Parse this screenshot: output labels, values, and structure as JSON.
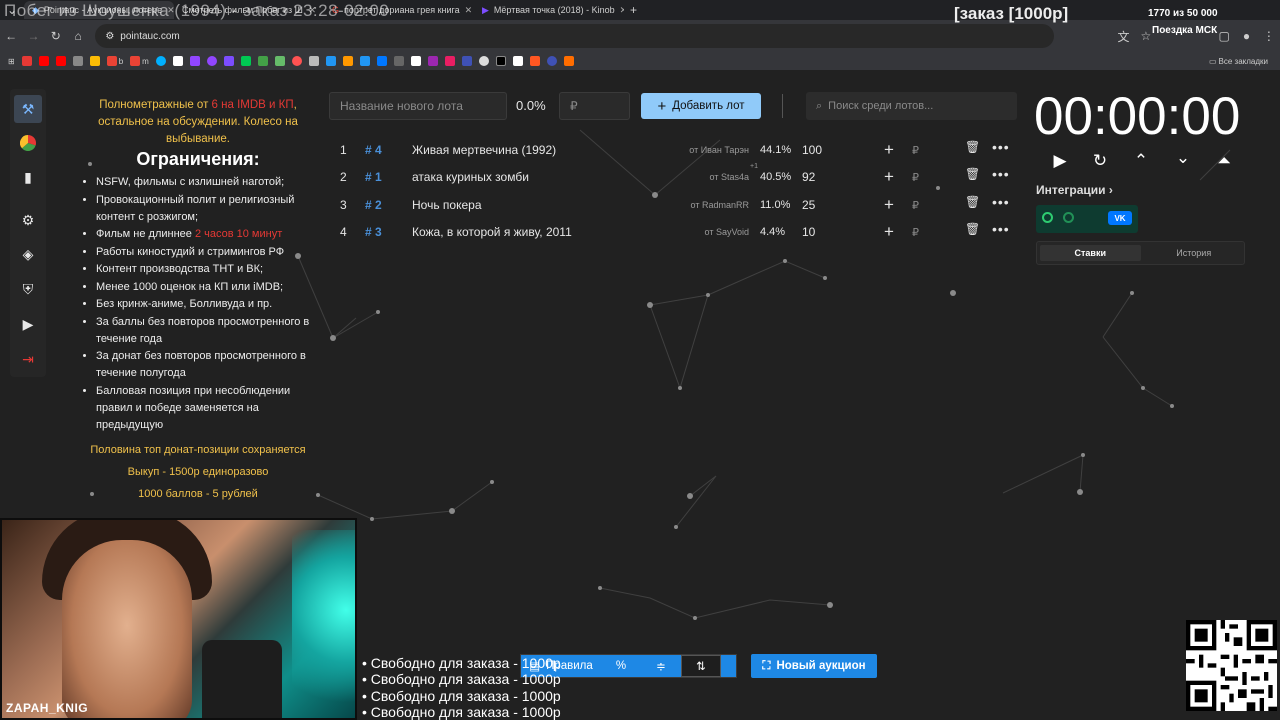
{
  "browser": {
    "tabs": [
      {
        "title": "Pointauc - Аукционы, лотере"
      },
      {
        "title": "Смотреть фильм Побег из Ш"
      },
      {
        "title": "портрет дориана грея книга"
      },
      {
        "title": "Мёртвая точка (2018) - Kinob"
      }
    ],
    "new_tab": "+",
    "url": "pointauc.com",
    "all_bookmarks": "Все закладки",
    "bookmark_labels": [
      "b",
      "m"
    ]
  },
  "stream_overlay": {
    "title": "Побег из Шоушенка (1994) - заказ 23:28-02:00",
    "order": "[заказ [1000р]",
    "counter": "1770  из 50 000",
    "trip": "Поездка МСК",
    "nickname": "ZAPAH_KNIG",
    "free_lines": [
      "• Свободно для заказа - 1000р",
      "• Свободно для заказа - 1000р",
      "• Свободно для заказа - 1000р",
      "• Свободно для заказа - 1000р"
    ]
  },
  "rules": {
    "intro_pre": "Полнометражные от ",
    "intro_red": "6 на IMDB и КП",
    "intro_post": ", остальное на обсуждении. Колесо на выбывание.",
    "heading": "Ограничения:",
    "items": [
      "NSFW, фильмы с излишней наготой;",
      "Провокационный полит и религиозный контент с розжигом;",
      "Работы киностудий и стримингов РФ",
      "Контент производства ТНТ и ВК;",
      "Менее 1000 оценок на КП или iMDB;",
      "Без кринж-аниме, Болливуда и пр.",
      "За баллы без повторов просмотренного в течение года",
      "За донат без повторов просмотренного в течение полугода",
      "Балловая позиция при несоблюдении правил и победе заменяется на предыдущую"
    ],
    "length_pre": "Фильм не длиннее ",
    "length_red": "2 часов 10 минут",
    "footer": [
      "Половина топ донат-позиции сохраняется",
      "Выкуп - 1500р единоразово",
      "1000 баллов - 5 рублей"
    ]
  },
  "form": {
    "lot_placeholder": "Название нового лота",
    "percent": "0.0%",
    "amount_placeholder": "₽",
    "add_label": "Добавить лот",
    "search_placeholder": "Поиск среди лотов..."
  },
  "lots": [
    {
      "num": "1",
      "tag": "# 4",
      "name": "Живая мертвечина (1992)",
      "from": "от Иван Тарэн",
      "pct": "44.1%",
      "amount": "100"
    },
    {
      "num": "2",
      "tag": "# 1",
      "name": "атака куриных зомби",
      "from": "от Stas4a",
      "pct": "40.5%",
      "amount": "92"
    },
    {
      "num": "3",
      "tag": "# 2",
      "name": "Ночь покера",
      "from": "от RadmanRR",
      "pct": "11.0%",
      "amount": "25"
    },
    {
      "num": "4",
      "tag": "# 3",
      "name": "Кожа, в которой я живу, 2011",
      "from": "от SayVoid",
      "pct": "4.4%",
      "amount": "10"
    }
  ],
  "lot_currency": "₽",
  "stas_badge": "+1",
  "timer": {
    "value": "00:00:00"
  },
  "integrations": {
    "label": "Интеграции",
    "vk": "VK"
  },
  "history_tabs": {
    "bids": "Ставки",
    "history": "История"
  },
  "bottom": {
    "rules": "Правила",
    "percent": "%",
    "new_auction": "Новый аукцион"
  },
  "colors": {
    "accent": "#90caf9",
    "primary": "#1e88e5",
    "gold": "#f0c14b",
    "red": "#e53935",
    "tag": "#4a90d9"
  }
}
